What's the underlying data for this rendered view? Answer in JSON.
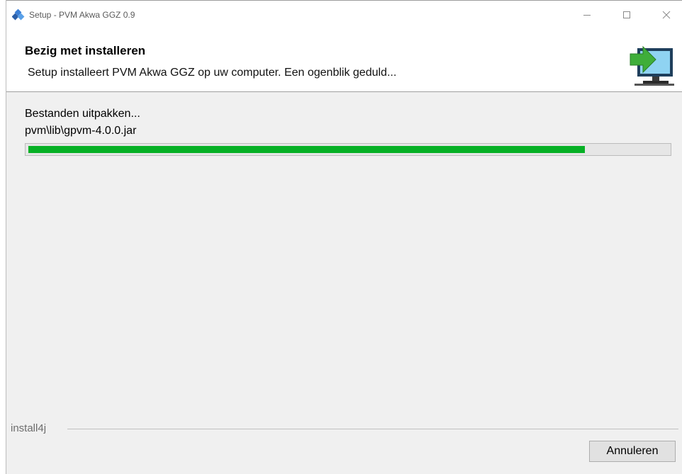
{
  "window": {
    "title": "Setup - PVM Akwa GGZ 0.9"
  },
  "header": {
    "title": "Bezig met installeren",
    "subtitle": "Setup installeert PVM Akwa GGZ op uw computer. Een ogenblik geduld..."
  },
  "progress": {
    "status": "Bestanden uitpakken...",
    "current_file": "pvm\\lib\\gpvm-4.0.0.jar",
    "fraction": 0.87
  },
  "footer": {
    "brand": "install4j",
    "cancel_label": "Annuleren"
  },
  "colors": {
    "progress_fill": "#06b025",
    "header_background": "#ffffff",
    "window_background": "#f0f0f0"
  },
  "icons": {
    "app": "installer-app-icon",
    "header": "monitor-arrow-icon"
  }
}
